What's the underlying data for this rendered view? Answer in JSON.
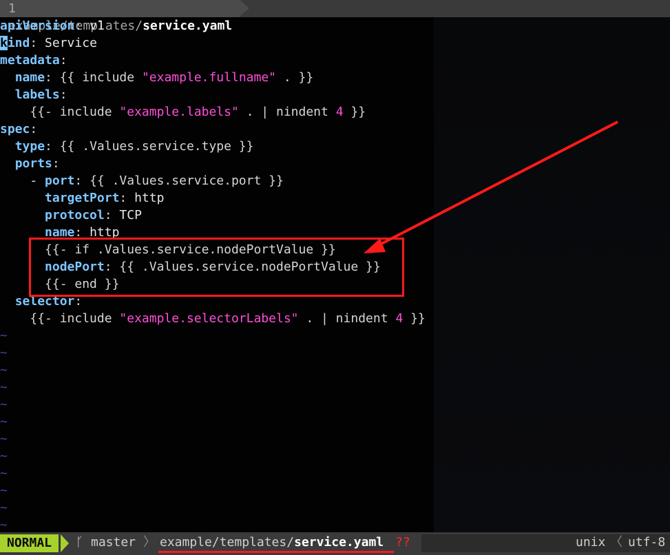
{
  "tabline": {
    "tab_number": "1",
    "tab_path": "example/templates/",
    "tab_file": "service.yaml"
  },
  "buffer": {
    "lines": [
      [
        {
          "c": "k",
          "t": "apiVersion"
        },
        {
          "c": "p",
          "t": ": "
        },
        {
          "c": "t",
          "t": "v1"
        }
      ],
      [
        {
          "c": "cursor",
          "t": "k"
        },
        {
          "c": "k",
          "t": "ind"
        },
        {
          "c": "p",
          "t": ": "
        },
        {
          "c": "t",
          "t": "Service"
        }
      ],
      [
        {
          "c": "k",
          "t": "metadata"
        },
        {
          "c": "p",
          "t": ":"
        }
      ],
      [
        {
          "c": "t",
          "t": "  "
        },
        {
          "c": "k",
          "t": "name"
        },
        {
          "c": "p",
          "t": ": {{ include "
        },
        {
          "c": "s",
          "t": "\"example.fullname\""
        },
        {
          "c": "p",
          "t": " . }}"
        }
      ],
      [
        {
          "c": "t",
          "t": "  "
        },
        {
          "c": "k",
          "t": "labels"
        },
        {
          "c": "p",
          "t": ":"
        }
      ],
      [
        {
          "c": "t",
          "t": "    "
        },
        {
          "c": "p",
          "t": "{{- include "
        },
        {
          "c": "s",
          "t": "\"example.labels\""
        },
        {
          "c": "p",
          "t": " . | nindent "
        },
        {
          "c": "s",
          "t": "4"
        },
        {
          "c": "p",
          "t": " }}"
        }
      ],
      [
        {
          "c": "k",
          "t": "spec"
        },
        {
          "c": "p",
          "t": ":"
        }
      ],
      [
        {
          "c": "t",
          "t": "  "
        },
        {
          "c": "k",
          "t": "type"
        },
        {
          "c": "p",
          "t": ": {{ .Values.service.type }}"
        }
      ],
      [
        {
          "c": "t",
          "t": "  "
        },
        {
          "c": "k",
          "t": "ports"
        },
        {
          "c": "p",
          "t": ":"
        }
      ],
      [
        {
          "c": "t",
          "t": "    - "
        },
        {
          "c": "k",
          "t": "port"
        },
        {
          "c": "p",
          "t": ": {{ .Values.service.port }}"
        }
      ],
      [
        {
          "c": "t",
          "t": "      "
        },
        {
          "c": "k",
          "t": "targetPort"
        },
        {
          "c": "p",
          "t": ": "
        },
        {
          "c": "t",
          "t": "http"
        }
      ],
      [
        {
          "c": "t",
          "t": "      "
        },
        {
          "c": "k",
          "t": "protocol"
        },
        {
          "c": "p",
          "t": ": "
        },
        {
          "c": "t",
          "t": "TCP"
        }
      ],
      [
        {
          "c": "t",
          "t": "      "
        },
        {
          "c": "k",
          "t": "name"
        },
        {
          "c": "p",
          "t": ": "
        },
        {
          "c": "t",
          "t": "http"
        }
      ],
      [
        {
          "c": "t",
          "t": "      "
        },
        {
          "c": "p",
          "t": "{{- if .Values.service.nodePortValue }}"
        }
      ],
      [
        {
          "c": "t",
          "t": "      "
        },
        {
          "c": "k",
          "t": "nodePort"
        },
        {
          "c": "p",
          "t": ": {{ .Values.service.nodePortValue }}"
        }
      ],
      [
        {
          "c": "t",
          "t": "      "
        },
        {
          "c": "p",
          "t": "{{- end }}"
        }
      ],
      [
        {
          "c": "t",
          "t": "  "
        },
        {
          "c": "k",
          "t": "selector"
        },
        {
          "c": "p",
          "t": ":"
        }
      ],
      [
        {
          "c": "t",
          "t": "    "
        },
        {
          "c": "p",
          "t": "{{- include "
        },
        {
          "c": "s",
          "t": "\"example.selectorLabels\""
        },
        {
          "c": "p",
          "t": " . | nindent "
        },
        {
          "c": "s",
          "t": "4"
        },
        {
          "c": "p",
          "t": " }}"
        }
      ]
    ],
    "empty_line_marker": "~",
    "empty_line_count": 12
  },
  "statusline": {
    "mode": "NORMAL",
    "branch_icon": "ᚴ",
    "branch": "master",
    "separator_left": "〉",
    "file_path": "example/templates/",
    "file_name": "service.yaml",
    "modified_flag": "??",
    "fileformat": "unix",
    "separator_right": "〈",
    "encoding": "utf-8"
  },
  "annotation": {
    "color": "#ff1a1a"
  }
}
